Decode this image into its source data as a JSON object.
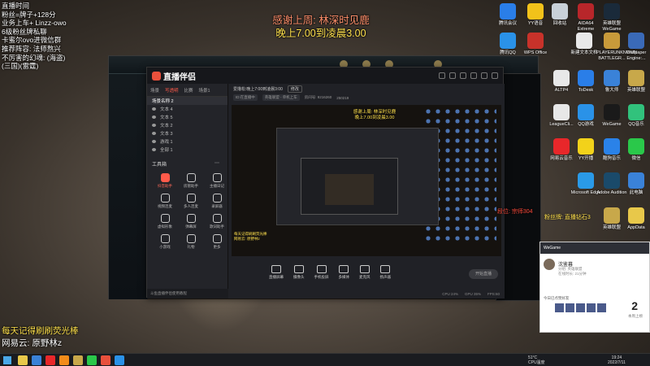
{
  "overlay": {
    "left_lines": [
      "直播时间",
      "粉丝=牌子+128分",
      "业务上车+ Linzz-owo",
      "6级粉丝牌私聊",
      "卡蜜尔ovo进微信群",
      "推荐阵容: 法师熬兴",
      "不厉害的幻魂: (海盗)",
      "(三国)(雷霆)"
    ],
    "center_lines": [
      "感谢上周: 林深时见鹿",
      "晚上7.00到凌晨3.00"
    ],
    "bottom_lines": [
      "每天记得刷刷荧光棒",
      "网易云: 原野林z"
    ],
    "side_red": "段位: 宗师304",
    "side_yellow": "粉丝牌: 直播钻石3"
  },
  "desktop_icons": [
    {
      "label": "腾讯会议",
      "color": "#2a7ee8"
    },
    {
      "label": "YY语音",
      "color": "#f2c21a"
    },
    {
      "label": "回收站",
      "color": "#c8d0d8"
    },
    {
      "label": "AIDA64 Extreme",
      "color": "#b8262a"
    },
    {
      "label": "英雄联盟WeGame",
      "color": "#1a2a3a"
    },
    {
      "label": "腾讯QQ",
      "color": "#2a92e8"
    },
    {
      "label": "WPS Office",
      "color": "#c8322a"
    },
    {
      "label": "新建文本文档",
      "color": "#e8e8e8"
    },
    {
      "label": "PLAYERUNKNOWN BATTLEGR...",
      "color": "#c89a3a"
    },
    {
      "label": "Wallpaper Engine:...",
      "color": "#3a6ab8"
    },
    {
      "label": "ALTP4",
      "color": "#e8e8e8"
    },
    {
      "label": "ToDesk",
      "color": "#2a7ee8"
    },
    {
      "label": "鲁大师",
      "color": "#3a82d8"
    },
    {
      "label": "英雄联盟",
      "color": "#c8a84a"
    },
    {
      "label": "LeagueCli...",
      "color": "#e8e8e8"
    },
    {
      "label": "QQ游戏",
      "color": "#2a92e8"
    },
    {
      "label": "WeGame",
      "color": "#1a1a1a"
    },
    {
      "label": "QQ音乐",
      "color": "#31c27c"
    },
    {
      "label": "网易云音乐",
      "color": "#e8272a"
    },
    {
      "label": "YY开播",
      "color": "#f2d21a"
    },
    {
      "label": "酷狗音乐",
      "color": "#2a82e8"
    },
    {
      "label": "微信",
      "color": "#2ac84a"
    },
    {
      "label": "Microsoft Edge",
      "color": "#2a9ae8"
    },
    {
      "label": "Adobe Audition",
      "color": "#1a4a6a"
    },
    {
      "label": "此电脑",
      "color": "#3a82d8"
    },
    {
      "label": "英雄联盟",
      "color": "#c8a84a"
    },
    {
      "label": "AppData",
      "color": "#e8c84a"
    }
  ],
  "app": {
    "logo": "直播伴侣",
    "tabs": [
      "场景",
      "写透明",
      "比赛",
      "场景1"
    ],
    "active_tab": 1,
    "scene_header": "场景名称 2",
    "scenes": [
      "文本 4",
      "文本 5",
      "文本 2",
      "文本 3",
      "游戏 1",
      "全部 1"
    ],
    "tools_title": "工具箱",
    "tools": [
      "抖音助手",
      "房管助手",
      "主播日记",
      "视频连麦",
      "多人连麦",
      "录屏器",
      "虚拟形象",
      "弹幕屏",
      "歌词助手",
      "小游戏",
      "礼物",
      "更多"
    ],
    "side_footer": "斗鱼直播伴侣使用教程",
    "stream_title": "爱撸松:晚上7:00到凌晨3:00",
    "edit_label": "修改",
    "info": [
      "ID:在直播中",
      "英雄联盟 - 单机上车",
      "房间号: 9216260",
      "250219"
    ],
    "preview_text": [
      "感谢上周: 林深时见鹿",
      "晚上7.00到凌晨3.00"
    ],
    "preview_red": [
      "每天记得刷刷荧光棒",
      "网易云: 原野林z"
    ],
    "preview_bottom": [
      "每天记得刷刷荧光棒",
      "网易云: 原野林z"
    ],
    "bottom_tools": [
      "直播屏幕",
      "摄像头",
      "手机投屏",
      "多媒体",
      "麦克风",
      "扬声器"
    ],
    "start_label": "开始直播",
    "footer_items": [
      "CPU 24%",
      "GPU 35%",
      "FPS:60"
    ]
  },
  "popup": {
    "header": "WeGame",
    "name": "沈鉴暮",
    "group_lines": [
      "分组: 英雄联盟",
      "在线时长: 21分钟"
    ],
    "feed": "今日已点赞好友",
    "count": "2",
    "count_label": "本周上榜"
  },
  "taskbar": {
    "tray_temp": "51°C",
    "tray_cpu": "CPU温度",
    "time": "19:24",
    "date": "2022/7/11"
  }
}
